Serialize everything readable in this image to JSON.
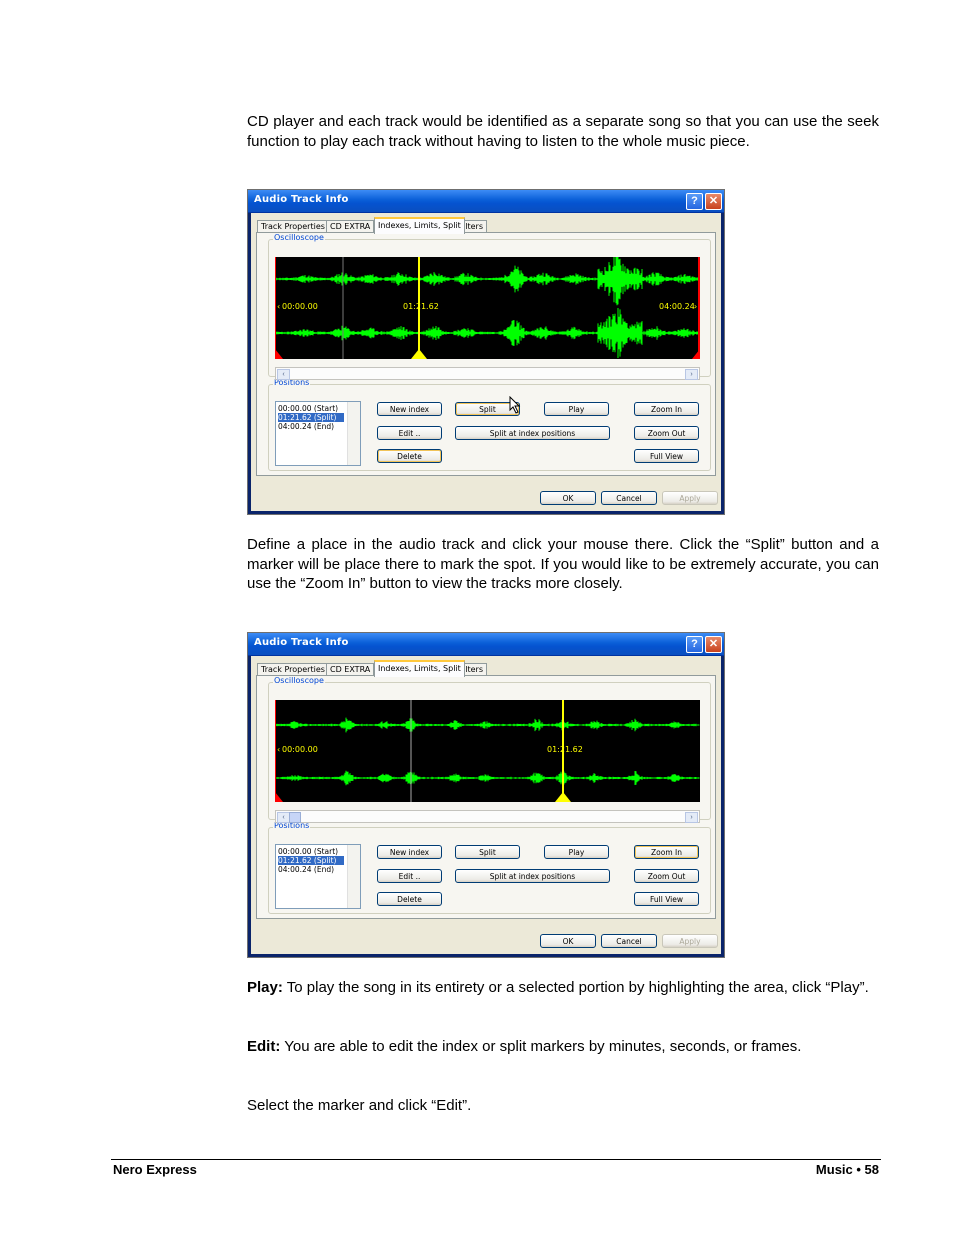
{
  "paragraphs": {
    "p1": "CD player and each track would be identified as a separate song so that you can use the seek function to play each track without having to listen to the whole music piece.",
    "p2": "Define a place in the audio track and click your mouse there. Click the “Split” button and a marker will be place there to mark the spot. If you would like to be extremely accurate, you can use the “Zoom In” button to view the tracks more closely.",
    "play_label": "Play:",
    "play_text": " To play the song in its entirety or a selected portion by highlighting the area, click “Play”.",
    "edit_label": "Edit:",
    "edit_text": " You are able to edit the index or split markers by minutes, seconds, or frames.",
    "p5": "Select the marker and click “Edit”."
  },
  "dialog": {
    "title": "Audio Track Info",
    "help_button": "?",
    "close_button": "✕",
    "tabs": [
      "Track Properties",
      "CD EXTRA",
      "Indexes, Limits, Split",
      "Filters"
    ],
    "oscilloscope_label": "Oscilloscope",
    "positions_label": "Positions",
    "positions": [
      "00:00.00 (Start)",
      "01:21.62 (Split)",
      "04:00.24 (End)"
    ],
    "buttons": {
      "new_index": "New index",
      "split": "Split",
      "play": "Play",
      "zoom_in": "Zoom In",
      "edit": "Edit ..",
      "split_at_index": "Split at index positions",
      "zoom_out": "Zoom Out",
      "delete": "Delete",
      "full_view": "Full View",
      "ok": "OK",
      "cancel": "Cancel",
      "apply": "Apply"
    },
    "shot1_times": [
      "00:00.00",
      "01:21.62",
      "04:00.24"
    ],
    "shot2_times": [
      "00:00.00",
      "01:21.62"
    ]
  },
  "footer": {
    "left": "Nero Express",
    "right": "Music • 58"
  },
  "colors": {
    "wave": "#00ff00",
    "marker_yellow": "#ffff00",
    "marker_red": "#ff0000",
    "title_blue": "#0a5fd8"
  }
}
